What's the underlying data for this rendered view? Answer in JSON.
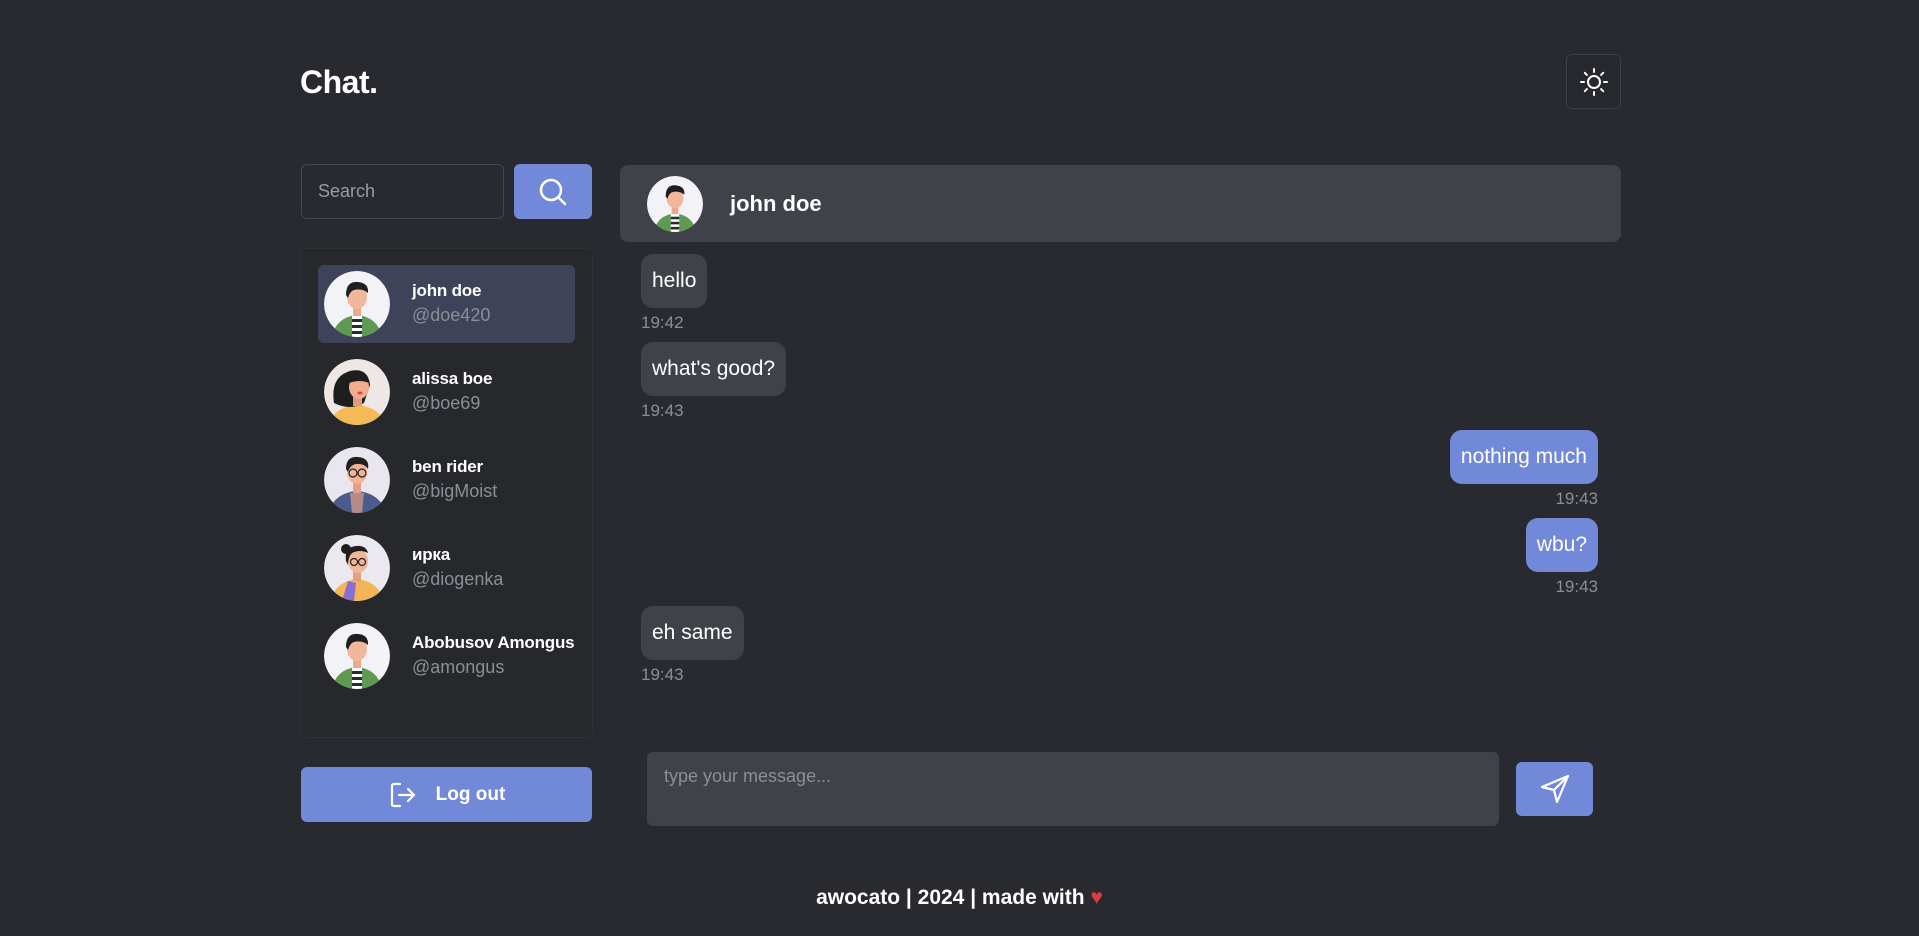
{
  "header": {
    "brand": "Chat.",
    "theme_toggle_icon": "sun-icon"
  },
  "search": {
    "placeholder": "Search",
    "button_icon": "search-icon"
  },
  "contacts": [
    {
      "name": "john doe",
      "handle": "@doe420",
      "active": true,
      "avatar": "man-green-striped"
    },
    {
      "name": "alissa boe",
      "handle": "@boe69",
      "active": false,
      "avatar": "woman-yellow"
    },
    {
      "name": "ben rider",
      "handle": "@bigMoist",
      "active": false,
      "avatar": "man-blue-jacket"
    },
    {
      "name": "ирка",
      "handle": "@diogenka",
      "active": false,
      "avatar": "woman-glasses"
    },
    {
      "name": "Abobusov Amongus",
      "handle": "@amongus",
      "active": false,
      "avatar": "man-green-striped"
    }
  ],
  "logout": {
    "label": "Log out",
    "icon": "logout-icon"
  },
  "chat": {
    "recipient_name": "john doe",
    "messages": [
      {
        "text": "hello",
        "time": "19:42",
        "direction": "in"
      },
      {
        "text": "what's good?",
        "time": "19:43",
        "direction": "in"
      },
      {
        "text": "nothing much",
        "time": "19:43",
        "direction": "out"
      },
      {
        "text": "wbu?",
        "time": "19:43",
        "direction": "out"
      },
      {
        "text": "eh same",
        "time": "19:43",
        "direction": "in"
      }
    ]
  },
  "composer": {
    "placeholder": "type your message...",
    "send_icon": "send-icon"
  },
  "footer": {
    "text": "awocato | 2024 | made with",
    "heart": "♥"
  },
  "colors": {
    "background": "#282a2f",
    "accent": "#7289da",
    "panel": "#404249",
    "muted_text": "#8b8e96",
    "heart": "#e03b45"
  }
}
